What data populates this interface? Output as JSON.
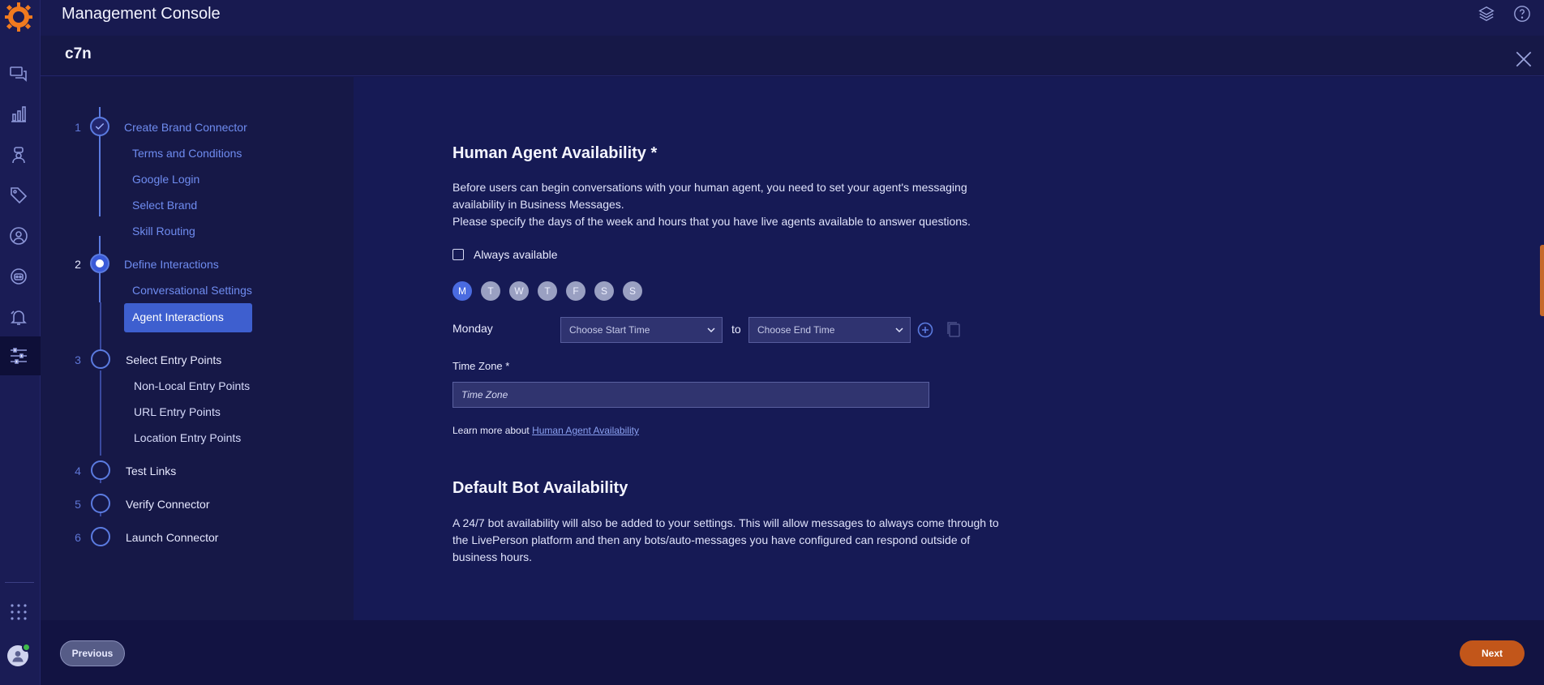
{
  "app": {
    "title": "Management Console"
  },
  "subheader": {
    "name": "c7n"
  },
  "rail": {
    "icons": [
      "conversations-icon",
      "analytics-icon",
      "agent-icon",
      "tags-icon",
      "profile-icon",
      "bot-icon",
      "notifications-icon",
      "settings-sliders-icon",
      "apps-grid-icon"
    ]
  },
  "stepper": {
    "steps": [
      {
        "number": "1",
        "label": "Create Brand Connector",
        "subs": [
          "Terms and Conditions",
          "Google Login",
          "Select Brand",
          "Skill Routing"
        ]
      },
      {
        "number": "2",
        "label": "Define Interactions",
        "subs": [
          "Conversational Settings",
          "Agent Interactions"
        ]
      },
      {
        "number": "3",
        "label": "Select Entry Points",
        "subs": [
          "Non-Local Entry Points",
          "URL Entry Points",
          "Location Entry Points"
        ]
      },
      {
        "number": "4",
        "label": "Test Links"
      },
      {
        "number": "5",
        "label": "Verify Connector"
      },
      {
        "number": "6",
        "label": "Launch Connector"
      }
    ]
  },
  "human": {
    "title": "Human Agent Availability *",
    "para1": "Before users can begin conversations with your human agent, you need to set your agent's messaging availability in Business Messages.",
    "para2": "Please specify the days of the week and hours that you have live agents available to answer questions.",
    "always_available": "Always available",
    "days": [
      "M",
      "T",
      "W",
      "T",
      "F",
      "S",
      "S"
    ],
    "selected_day": "Monday",
    "start_placeholder": "Choose Start Time",
    "to": "to",
    "end_placeholder": "Choose End Time",
    "timezone_label": "Time Zone *",
    "timezone_placeholder": "Time Zone",
    "learn_prefix": "Learn more about",
    "learn_link": "Human Agent Availability"
  },
  "bot": {
    "title": "Default Bot Availability",
    "para": "A 24/7 bot availability will also be added to your settings. This will allow messages to always come through to the LivePerson platform and then any bots/auto-messages you have configured can respond outside of business hours."
  },
  "footer": {
    "previous": "Previous",
    "next": "Next"
  },
  "colors": {
    "accent": "#3e5fcf",
    "next_button": "#c2561a",
    "background": "#15164a"
  }
}
